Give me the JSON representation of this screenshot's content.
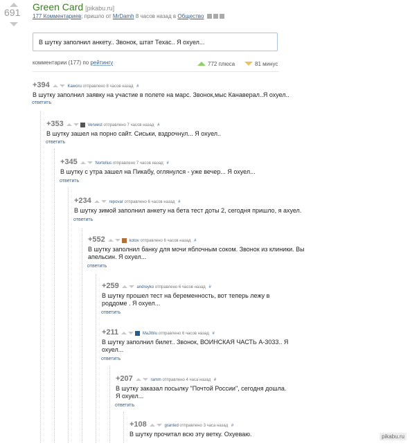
{
  "post": {
    "rating": "691",
    "title": "Green Card",
    "source": "[pikabu.ru]",
    "comments_link": "177 Комментариев",
    "meta_middle": "; пришло от",
    "author": "MrDamh",
    "meta_time": "8 часов назад в",
    "category": "Общество",
    "body": "В шутку заполнил анкету.. Звонок, штат Техас.. Я охуел..."
  },
  "comments_bar": {
    "label": "комментарии (177) по",
    "sort": "рейтингу",
    "plus": "772 плюса",
    "minus": "81 минус"
  },
  "comments": [
    {
      "score": "+394",
      "user": "Kaworu",
      "time": "отправлено 8 часов назад",
      "text": "В шутку заполнил заявку на участие в полете на марс. Звонок,мыс Канаверал..Я охуел..",
      "reply": "ответить"
    },
    {
      "score": "+353",
      "user": "Verwest",
      "time": "отправлено 7 часов назад",
      "text": "В шутку зашел на порно сайт. Сиськи, вздрочнул... Я охуел..",
      "reply": "ответить"
    },
    {
      "score": "+345",
      "user": "Nortellus",
      "time": "отправлено 7 часов назад",
      "text": "В шутку с утра зашел на Пикабу, оглянулся - уже вечер... Я охуел...",
      "reply": "ответить"
    },
    {
      "score": "+234",
      "user": "repovar",
      "time": "отправлено 6 часов назад",
      "text": "В шутку зимой заполнил анкету на бета тест доты 2, сегодня пришло, я ахуел.",
      "reply": "ответить"
    },
    {
      "score": "+552",
      "user": "kotov",
      "time": "отправлено 6 часов назад",
      "text1": "В шутку заполнил банку для мочи яблочным соком. Звонок из клиники. Вы",
      "text2": "апельсин. Я охуел...",
      "reply": "ответить"
    },
    {
      "score": "+259",
      "user": "andreyko",
      "time": "отправлено 6 часов назад",
      "text1": "В шутку прошел тест на беременность, вот теперь лежу в",
      "text2": "роддоме . Я охуел...",
      "reply": "ответить"
    },
    {
      "score": "+211",
      "user": "MaJIbIu",
      "time": "отправлено 6 часов назад",
      "text1": "В шутку заполнил билет.. Звонок, ВОИНСКАЯ ЧАСТЬ А-3033.. Я",
      "text2": "охуел...",
      "reply": "ответить"
    },
    {
      "score": "+207",
      "user": "ramm",
      "time": "отправлено 4 часа назад",
      "text1": "В шутку заказал посылку \"Почтой России\", сегодня дошла.",
      "text2": "Я охуел...",
      "reply": "ответить"
    },
    {
      "score": "+108",
      "user": "granted",
      "time": "отправлено 3 часа назад",
      "text": "В шутку прочитал всю эту ветку. Охуеваю.",
      "reply": ""
    }
  ],
  "hash_symbol": "#",
  "watermark": "pikabu.ru"
}
